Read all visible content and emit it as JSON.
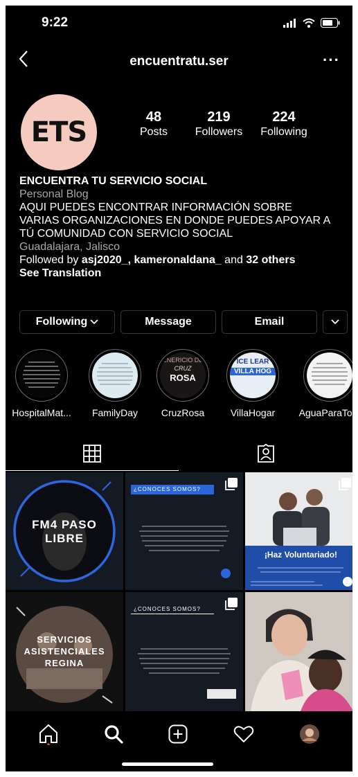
{
  "status": {
    "time": "9:22"
  },
  "nav": {
    "title": "encuentratu.ser",
    "more": "···"
  },
  "profile": {
    "avatar_text": "ETS"
  },
  "stats": [
    {
      "value": "48",
      "label": "Posts"
    },
    {
      "value": "219",
      "label": "Followers"
    },
    {
      "value": "224",
      "label": "Following"
    }
  ],
  "bio": {
    "name": "ENCUENTRA TU SERVICIO SOCIAL",
    "category": "Personal Blog",
    "line1": "AQUI PUEDES ENCONTRAR INFORMACIÓN SOBRE",
    "line2": "VARIAS ORGANIZACIONES EN DONDE PUEDES APOYAR A",
    "line3": "TÚ COMUNIDAD CON SERVICIO SOCIAL",
    "location": "Guadalajara, Jalisco",
    "followed_prefix": "Followed by ",
    "followed_users": "asj2020_, kameronaldana_",
    "followed_mid": " and ",
    "followed_others": "32 others",
    "see_translation": "See Translation"
  },
  "buttons": {
    "following": "Following",
    "message": "Message",
    "email": "Email"
  },
  "highlights": [
    {
      "label": "HospitalMat..."
    },
    {
      "label": "FamilyDay"
    },
    {
      "label": "CruzRosa",
      "art_top": "ENERICIO DE",
      "art_mid": "CRUZ",
      "art_bot": "ROSA"
    },
    {
      "label": "VillaHogar",
      "art_top": "ICE LEAR",
      "art_mid": "VILLA HOG"
    },
    {
      "label": "AguaParaTo..."
    }
  ],
  "posts": {
    "p1": {
      "line1": "FM4 PASO",
      "line2": "LIBRE"
    },
    "p2": {
      "header": "¿CONOCES SOMOS?"
    },
    "p3": {
      "caption": "¡Haz Voluntariado!"
    },
    "p4": {
      "line1": "SERVICIOS",
      "line2": "ASISTENCIALES",
      "line3": "REGINA"
    },
    "p5": {
      "header": "¿CONOCES SOMOS?"
    }
  },
  "colors": {
    "background": "#000000",
    "secondary_text": "#a8a8a8",
    "border": "#363636",
    "accent_blue": "#2a66d9"
  }
}
